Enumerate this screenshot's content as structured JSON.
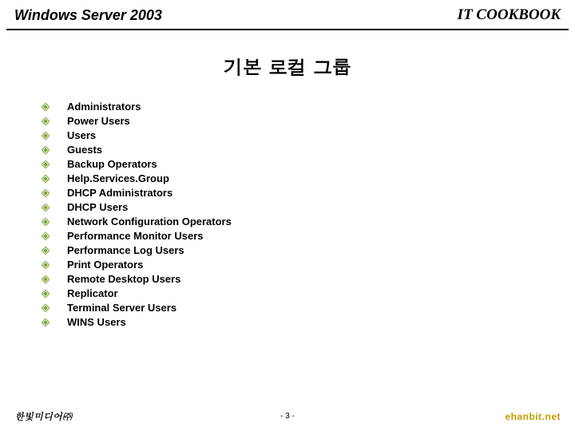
{
  "header": {
    "left": "Windows Server 2003",
    "right": "IT COOKBOOK"
  },
  "title": "기본 로컬 그룹",
  "groups": [
    "Administrators",
    "Power Users",
    "Users",
    "Guests",
    "Backup Operators",
    "Help.Services.Group",
    "DHCP Administrators",
    "DHCP Users",
    "Network Configuration Operators",
    "Performance Monitor Users",
    "Performance Log Users",
    "Print Operators",
    "Remote Desktop Users",
    "Replicator",
    "Terminal Server Users",
    "WINS Users"
  ],
  "footer": {
    "left": "한빛미디어㈜",
    "center": "- 3 -",
    "right": "ehanbit.net"
  }
}
